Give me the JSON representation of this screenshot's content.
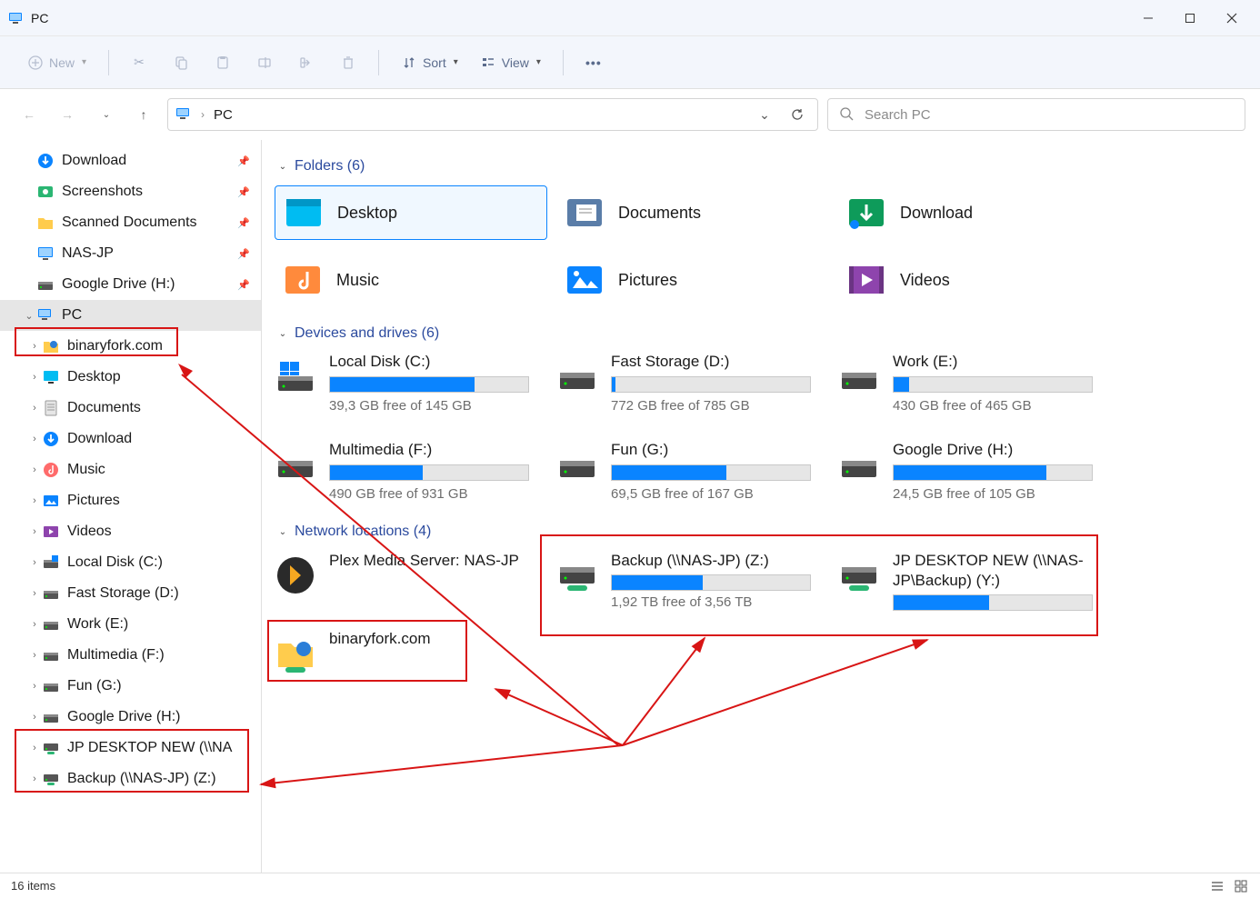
{
  "window": {
    "title": "PC",
    "min_tooltip": "Minimize",
    "max_tooltip": "Maximize",
    "close_tooltip": "Close"
  },
  "cmdbar": {
    "new_label": "New",
    "sort_label": "Sort",
    "view_label": "View"
  },
  "breadcrumb": {
    "root": "PC"
  },
  "search": {
    "placeholder": "Search PC"
  },
  "sidebar": {
    "quick": [
      {
        "label": "Download",
        "icon": "download"
      },
      {
        "label": "Screenshots",
        "icon": "screenshot"
      },
      {
        "label": "Scanned Documents",
        "icon": "folder"
      },
      {
        "label": "NAS-JP",
        "icon": "monitor"
      },
      {
        "label": "Google Drive (H:)",
        "icon": "drive"
      }
    ],
    "pc_label": "PC",
    "pc_children": [
      {
        "label": "binaryfork.com",
        "icon": "net-folder"
      },
      {
        "label": "Desktop",
        "icon": "desktop"
      },
      {
        "label": "Documents",
        "icon": "doc"
      },
      {
        "label": "Download",
        "icon": "download"
      },
      {
        "label": "Music",
        "icon": "music"
      },
      {
        "label": "Pictures",
        "icon": "pictures"
      },
      {
        "label": "Videos",
        "icon": "videos"
      },
      {
        "label": "Local Disk (C:)",
        "icon": "disk"
      },
      {
        "label": "Fast Storage (D:)",
        "icon": "drive"
      },
      {
        "label": "Work (E:)",
        "icon": "drive"
      },
      {
        "label": "Multimedia (F:)",
        "icon": "drive"
      },
      {
        "label": "Fun (G:)",
        "icon": "drive"
      },
      {
        "label": "Google Drive (H:)",
        "icon": "drive"
      },
      {
        "label": "JP DESKTOP NEW (\\\\NAS-JP\\Backup) (Y:)",
        "icon": "net-drive",
        "display": "JP DESKTOP NEW (\\\\NA"
      },
      {
        "label": "Backup (\\\\NAS-JP) (Z:)",
        "icon": "net-drive"
      }
    ]
  },
  "sections": {
    "folders": {
      "title": "Folders",
      "count": 6
    },
    "drives": {
      "title": "Devices and drives",
      "count": 6
    },
    "network": {
      "title": "Network locations",
      "count": 4
    }
  },
  "folders": [
    {
      "name": "Desktop",
      "icon": "desktop-folder",
      "selected": true
    },
    {
      "name": "Documents",
      "icon": "documents-folder"
    },
    {
      "name": "Download",
      "icon": "download-folder"
    },
    {
      "name": "Music",
      "icon": "music-folder"
    },
    {
      "name": "Pictures",
      "icon": "pictures-folder"
    },
    {
      "name": "Videos",
      "icon": "videos-folder"
    }
  ],
  "drives": [
    {
      "name": "Local Disk (C:)",
      "sub": "39,3 GB free of 145 GB",
      "fill": 73,
      "icon": "win-drive"
    },
    {
      "name": "Fast Storage (D:)",
      "sub": "772 GB free of 785 GB",
      "fill": 2,
      "icon": "hdd"
    },
    {
      "name": "Work (E:)",
      "sub": "430 GB free of 465 GB",
      "fill": 8,
      "icon": "hdd"
    },
    {
      "name": "Multimedia (F:)",
      "sub": "490 GB free of 931 GB",
      "fill": 47,
      "icon": "hdd"
    },
    {
      "name": "Fun (G:)",
      "sub": "69,5 GB free of 167 GB",
      "fill": 58,
      "icon": "hdd"
    },
    {
      "name": "Google Drive (H:)",
      "sub": "24,5 GB free of 105 GB",
      "fill": 77,
      "icon": "hdd"
    }
  ],
  "network": [
    {
      "name": "Plex Media Server: NAS-JP",
      "icon": "plex",
      "has_bar": false
    },
    {
      "name": "Backup (\\\\NAS-JP) (Z:)",
      "sub": "1,92 TB free of 3,56 TB",
      "fill": 46,
      "icon": "net-hdd",
      "has_bar": true
    },
    {
      "name": "JP DESKTOP NEW (\\\\NAS-JP\\Backup) (Y:)",
      "fill": 48,
      "icon": "net-hdd",
      "has_bar": true
    },
    {
      "name": "binaryfork.com",
      "icon": "net-folder",
      "has_bar": false
    }
  ],
  "statusbar": {
    "left": "16 items"
  }
}
